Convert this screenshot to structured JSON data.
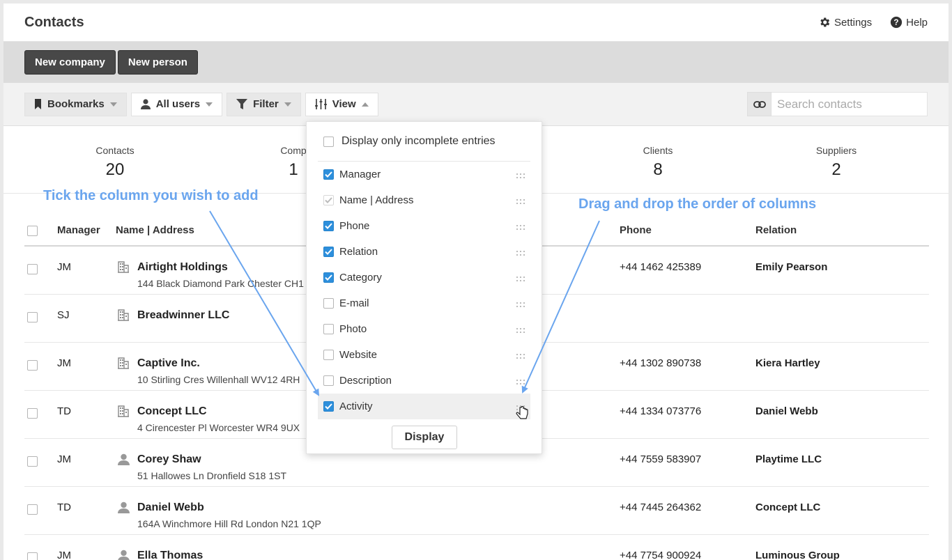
{
  "header": {
    "title": "Contacts",
    "settings_label": "Settings",
    "help_label": "Help"
  },
  "actions": {
    "new_company": "New company",
    "new_person": "New person"
  },
  "toolbar": {
    "bookmarks": "Bookmarks",
    "all_users": "All users",
    "filter": "Filter",
    "view": "View",
    "search_placeholder": "Search contacts"
  },
  "stats": [
    {
      "label": "Contacts",
      "value": "20"
    },
    {
      "label": "Comp",
      "value": "1"
    },
    {
      "label": "Clients",
      "value": "8"
    },
    {
      "label": "Suppliers",
      "value": "2"
    }
  ],
  "table": {
    "headers": {
      "manager": "Manager",
      "name_address": "Name | Address",
      "phone": "Phone",
      "relation": "Relation"
    },
    "rows": [
      {
        "manager": "JM",
        "type": "company",
        "name": "Airtight Holdings",
        "address": "144 Black Diamond Park Chester CH1",
        "phone": "+44 1462 425389",
        "relation": "Emily Pearson"
      },
      {
        "manager": "SJ",
        "type": "company",
        "name": "Breadwinner LLC",
        "address": "",
        "phone": "",
        "relation": ""
      },
      {
        "manager": "JM",
        "type": "company",
        "name": "Captive Inc.",
        "address": "10 Stirling Cres Willenhall WV12 4RH",
        "phone": "+44 1302 890738",
        "relation": "Kiera Hartley"
      },
      {
        "manager": "TD",
        "type": "company",
        "name": "Concept LLC",
        "address": "4 Cirencester Pl Worcester WR4 9UX",
        "phone": "+44 1334 073776",
        "relation": "Daniel Webb"
      },
      {
        "manager": "JM",
        "type": "person",
        "name": "Corey Shaw",
        "address": "51 Hallowes Ln Dronfield S18 1ST",
        "phone": "+44 7559 583907",
        "relation": "Playtime LLC"
      },
      {
        "manager": "TD",
        "type": "person",
        "name": "Daniel Webb",
        "address": "164A Winchmore Hill Rd London N21 1QP",
        "phone": "+44 7445 264362",
        "relation": "Concept LLC"
      },
      {
        "manager": "JM",
        "type": "person",
        "name": "Ella Thomas",
        "address": "",
        "phone": "+44 7754 900924",
        "relation": "Luminous Group"
      }
    ]
  },
  "view_menu": {
    "incomplete_label": "Display only incomplete entries",
    "columns": [
      {
        "label": "Manager",
        "checked": true
      },
      {
        "label": "Name | Address",
        "checked": true,
        "disabled": true
      },
      {
        "label": "Phone",
        "checked": true
      },
      {
        "label": "Relation",
        "checked": true
      },
      {
        "label": "Category",
        "checked": true
      },
      {
        "label": "E-mail",
        "checked": false
      },
      {
        "label": "Photo",
        "checked": false
      },
      {
        "label": "Website",
        "checked": false
      },
      {
        "label": "Description",
        "checked": false
      },
      {
        "label": "Activity",
        "checked": true
      }
    ],
    "display_button": "Display"
  },
  "annotations": {
    "left": "Tick the column you wish to add",
    "right": "Drag and drop the order of columns"
  },
  "colors": {
    "accent": "#2d8fdc",
    "annotation": "#6aa5ee",
    "dark_button": "#484848"
  }
}
